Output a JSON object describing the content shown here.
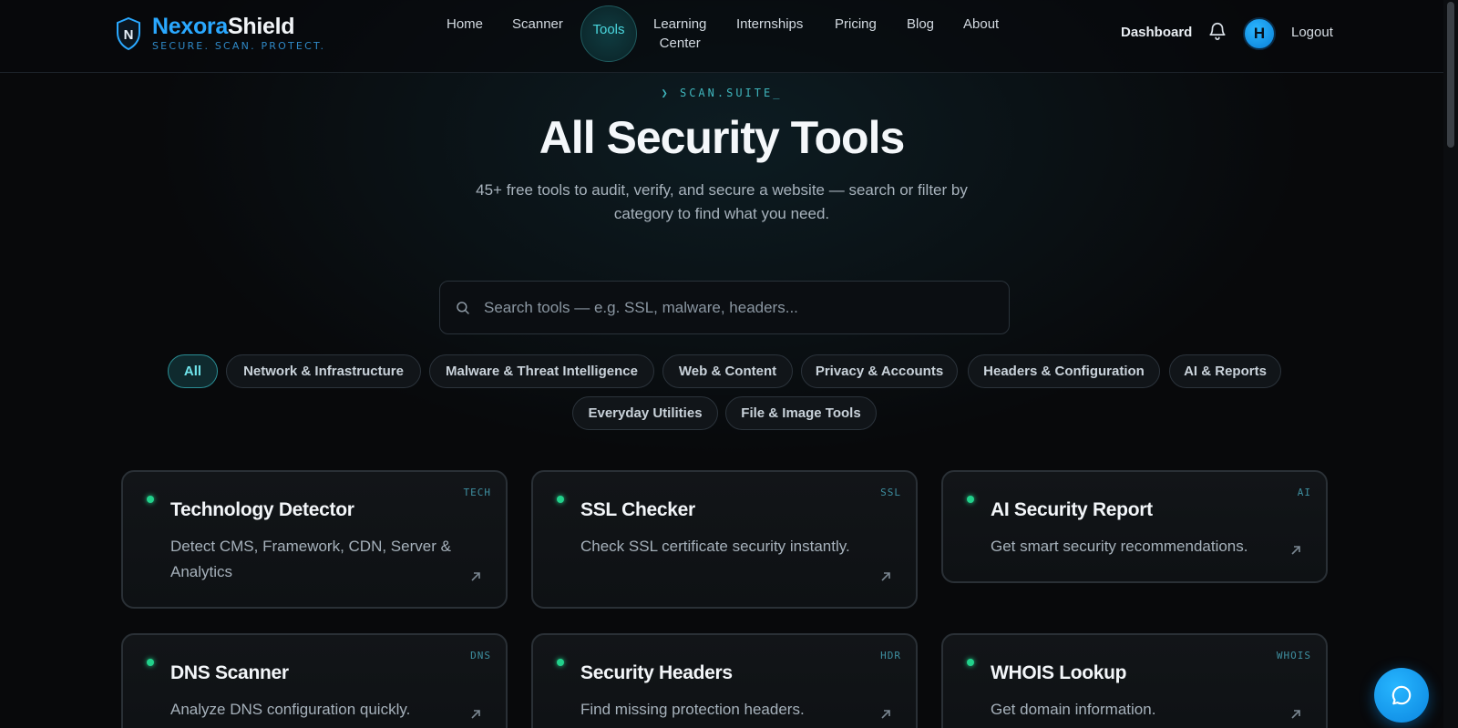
{
  "brand": {
    "name_part1": "Nexora",
    "name_part2": "Shield",
    "tagline": "SECURE. SCAN. PROTECT."
  },
  "nav": {
    "home": "Home",
    "scanner": "Scanner",
    "tools": "Tools",
    "learning_line1": "Learning",
    "learning_line2": "Center",
    "internships": "Internships",
    "pricing": "Pricing",
    "blog": "Blog",
    "about": "About",
    "active": "Tools"
  },
  "user": {
    "dashboard": "Dashboard",
    "avatar_initial": "H",
    "logout": "Logout"
  },
  "hero": {
    "eyebrow": "❯ SCAN.SUITE_",
    "title": "All Security Tools",
    "subtitle": "45+ free tools to audit, verify, and secure a website — search or filter by category to find what you need."
  },
  "search": {
    "placeholder": "Search tools — e.g. SSL, malware, headers..."
  },
  "filters": [
    "All",
    "Network & Infrastructure",
    "Malware & Threat Intelligence",
    "Web & Content",
    "Privacy & Accounts",
    "Headers & Configuration",
    "AI & Reports",
    "Everyday Utilities",
    "File & Image Tools"
  ],
  "active_filter": "All",
  "tools": [
    {
      "title": "Technology Detector",
      "desc": "Detect CMS, Framework, CDN, Server & Analytics",
      "tag": "TECH"
    },
    {
      "title": "SSL Checker",
      "desc": "Check SSL certificate security instantly.",
      "tag": "SSL"
    },
    {
      "title": "AI Security Report",
      "desc": "Get smart security recommendations.",
      "tag": "AI"
    },
    {
      "title": "DNS Scanner",
      "desc": "Analyze DNS configuration quickly.",
      "tag": "DNS"
    },
    {
      "title": "Security Headers",
      "desc": "Find missing protection headers.",
      "tag": "HDR"
    },
    {
      "title": "WHOIS Lookup",
      "desc": "Get domain information.",
      "tag": "WHOIS"
    }
  ],
  "colors": {
    "accent": "#2aa8ff",
    "teal": "#4ad6dd",
    "status_dot": "#22d18b",
    "background": "#07090b"
  },
  "icons": {
    "logo": "shield-icon",
    "notification": "bell-icon",
    "search": "search-icon",
    "card_link": "arrow-up-right-icon",
    "chat": "chat-bubble-icon"
  }
}
